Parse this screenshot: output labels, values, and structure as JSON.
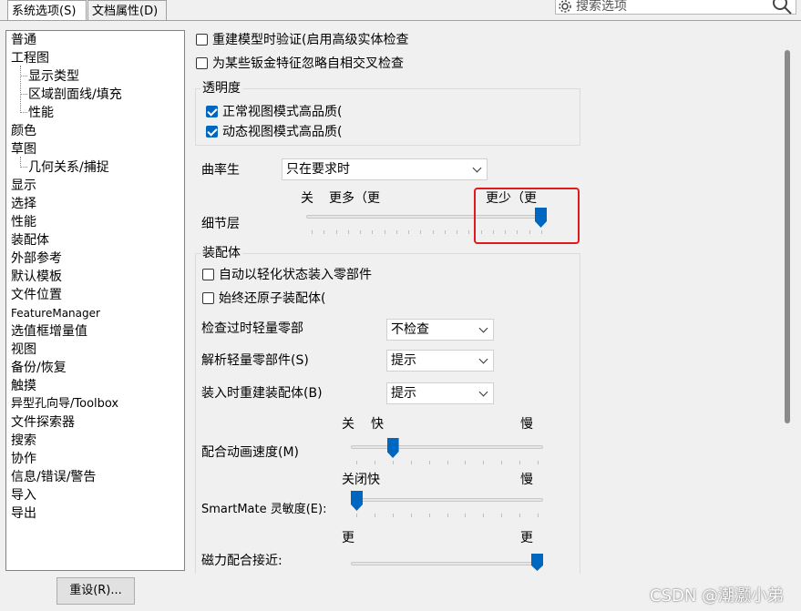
{
  "tabs": [
    {
      "label": "系统选项(S)",
      "active": true
    },
    {
      "label": "文档属性(D)",
      "active": false
    }
  ],
  "search": {
    "placeholder": "搜索选项"
  },
  "nav": {
    "items": [
      {
        "label": "普通"
      },
      {
        "label": "工程图"
      },
      {
        "label": "显示类型",
        "child": true
      },
      {
        "label": "区域剖面线/填充",
        "child": true
      },
      {
        "label": "性能",
        "child": true
      },
      {
        "label": "颜色"
      },
      {
        "label": "草图"
      },
      {
        "label": "几何关系/捕捉",
        "child": true
      },
      {
        "label": "显示"
      },
      {
        "label": "选择"
      },
      {
        "label": "性能"
      },
      {
        "label": "装配体"
      },
      {
        "label": "外部参考"
      },
      {
        "label": "默认模板"
      },
      {
        "label": "文件位置"
      },
      {
        "label": "FeatureManager"
      },
      {
        "label": "选值框增量值"
      },
      {
        "label": "视图"
      },
      {
        "label": "备份/恢复"
      },
      {
        "label": "触摸"
      },
      {
        "label": "异型孔向导/Toolbox"
      },
      {
        "label": "文件探索器"
      },
      {
        "label": "搜索"
      },
      {
        "label": "协作"
      },
      {
        "label": "信息/错误/警告"
      },
      {
        "label": "导入"
      },
      {
        "label": "导出"
      }
    ]
  },
  "reset_button": "重设(R)...",
  "options": {
    "rebuild_verify": {
      "label": "重建模型时验证(启用高级实体检查",
      "checked": false
    },
    "ignore_sheetmetal": {
      "label": "为某些钣金特征忽略自相交叉检查",
      "checked": false
    }
  },
  "transparency": {
    "title": "透明度",
    "normal_hq": {
      "label": "正常视图模式高品质(",
      "checked": true
    },
    "dynamic_hq": {
      "label": "动态视图模式高品质(",
      "checked": true
    }
  },
  "curvature": {
    "label": "曲率生",
    "value": "只在要求时"
  },
  "detail_level": {
    "label": "细节层",
    "left_labels": [
      "关",
      "更多（更"
    ],
    "right_label": "更少（更",
    "value_fraction": 1.0
  },
  "assembly": {
    "title": "装配体",
    "auto_lightweight": {
      "label": "自动以轻化状态装入零部件",
      "checked": false
    },
    "always_resolve": {
      "label": "始终还原子装配体(",
      "checked": false
    },
    "check_outdated": {
      "label": "检查过时轻量零部",
      "value": "不检查"
    },
    "resolve_lightweight": {
      "label": "解析轻量零部件(S)",
      "value": "提示"
    },
    "rebuild_on_load": {
      "label": "装入时重建装配体(B)",
      "value": "提示"
    }
  },
  "mate_animation": {
    "label": "配合动画速度(M)",
    "scale_left": [
      "关",
      "快"
    ],
    "scale_right": "慢",
    "value_fraction": 0.2
  },
  "smartmate": {
    "label": "SmartMate 灵敏度(E):",
    "scale_left": "关闭快",
    "scale_right": "慢",
    "value_fraction": 0.0
  },
  "magnetic_mate": {
    "label": "磁力配合接近:",
    "scale_left": "更",
    "scale_right": "更",
    "value_fraction": 1.0
  },
  "watermark": "CSDN @潮灏小弟",
  "colors": {
    "accent": "#0067c0",
    "highlight": "#e0191b"
  }
}
